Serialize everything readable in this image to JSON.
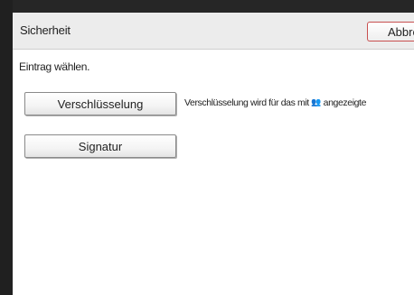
{
  "header": {
    "title": "Sicherheit",
    "cancel_label": "Abbre"
  },
  "main": {
    "instruction": "Eintrag wählen.",
    "encryption_button": "Verschlüsselung",
    "encryption_desc_before": "Verschlüsselung wird für das mit",
    "encryption_desc_after": "angezeigte",
    "signature_button": "Signatur"
  },
  "icons": {
    "encryption_marker": "people-lock-icon"
  },
  "colors": {
    "cancel_border": "#c85050",
    "header_bg": "#ececec"
  }
}
